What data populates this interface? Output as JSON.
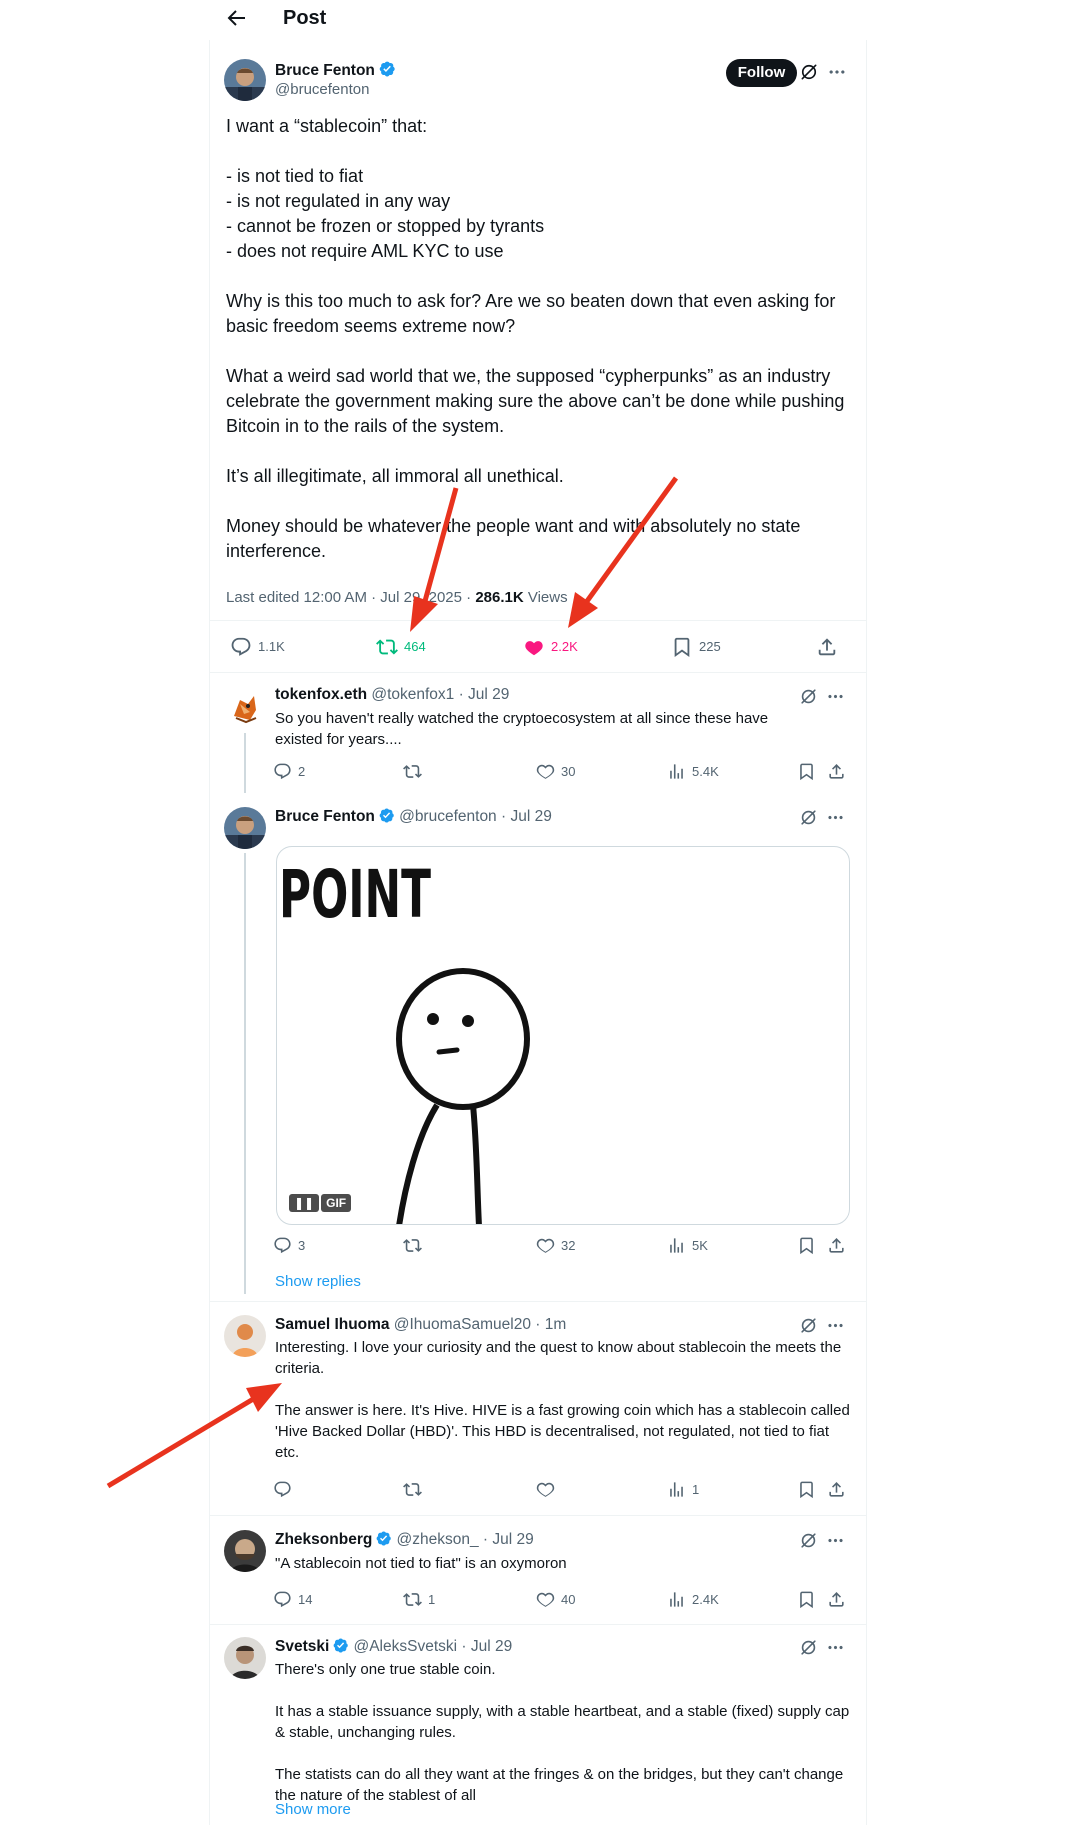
{
  "header": {
    "title": "Post"
  },
  "main_post": {
    "author": "Bruce Fenton",
    "handle": "@brucefenton",
    "follow_label": "Follow",
    "body": [
      "I want a “stablecoin” that:",
      "",
      "- is not tied to fiat",
      "- is not regulated in any way",
      "- cannot be frozen or stopped by tyrants",
      "- does not require AML KYC to use",
      "",
      "Why is this too much to ask for?  Are we so beaten down that even asking for basic freedom seems extreme now?",
      "",
      "What a weird sad world that we, the supposed “cypherpunks” as an industry celebrate the government making sure the above can’t be done while pushing Bitcoin in to the rails of the system.",
      "",
      "It’s all illegitimate, all immoral all unethical.",
      "",
      "Money should be whatever the people want and with absolutely no state interference."
    ],
    "meta_prefix": "Last edited 12:00 AM · Jul 29, 2025 · ",
    "views_count": "286.1K",
    "views_label": " Views",
    "stats": {
      "replies": "1.1K",
      "reposts": "464",
      "likes": "2.2K",
      "bookmarks": "225"
    }
  },
  "replies": [
    {
      "name": "tokenfox.eth",
      "handle": "@tokenfox1 · Jul 29",
      "text": [
        "So you haven't really watched the cryptoecosystem at all since these have existed for years...."
      ],
      "stats": {
        "replies": "2",
        "reposts": "",
        "likes": "30",
        "views": "5.4K"
      }
    },
    {
      "name": "Bruce Fenton",
      "handle": "@brucefenton · Jul 29",
      "gif_caption": "POINT",
      "gif_label": "GIF",
      "stats": {
        "replies": "3",
        "reposts": "",
        "likes": "32",
        "views": "5K"
      },
      "show_replies": "Show replies"
    },
    {
      "name": "Samuel Ihuoma",
      "handle": "@IhuomaSamuel20 · 1m",
      "text": [
        "Interesting. I love your curiosity and the quest to know about stablecoin the meets the criteria.",
        "",
        "The answer is here. It's Hive. HIVE is a fast growing coin which has a stablecoin called 'Hive Backed Dollar (HBD)'. This HBD is decentralised, not regulated, not tied to fiat etc."
      ],
      "stats": {
        "replies": "",
        "reposts": "",
        "likes": "",
        "views": "1"
      }
    },
    {
      "name": "Zheksonberg",
      "handle": "@zhekson_ · Jul 29",
      "text": [
        "\"A stablecoin not tied to fiat\" is an oxymoron"
      ],
      "stats": {
        "replies": "14",
        "reposts": "1",
        "likes": "40",
        "views": "2.4K"
      }
    },
    {
      "name": "Svetski",
      "handle": "@AleksSvetski · Jul 29",
      "text": [
        "There's only one true stable coin.",
        "",
        "It has a stable issuance supply, with a stable heartbeat, and a stable (fixed) supply cap & stable, unchanging rules.",
        "",
        "The statists can do all they want at the fringes & on the bridges, but they can't change the nature of the stablest of all"
      ],
      "show_more": "Show more"
    }
  ],
  "colors": {
    "accent": "#1d9bf0",
    "repost": "#00ba7c",
    "like": "#f91880",
    "annotation": "#e8331e"
  }
}
